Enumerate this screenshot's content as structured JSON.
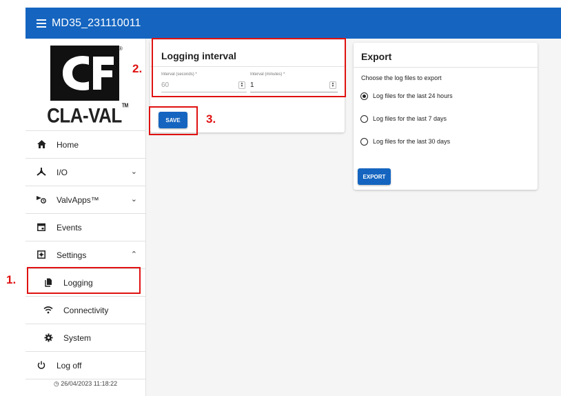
{
  "topbar": {
    "title": "MD35_231110011",
    "menu_icon": "hamburger-menu-icon",
    "background": "#1565c0"
  },
  "sidebar": {
    "logo": {
      "wordmark": "CLA-VAL",
      "trademark": "TM",
      "registered": "®"
    },
    "items": [
      {
        "label": "Home",
        "icon": "home-icon"
      },
      {
        "label": "I/O",
        "icon": "io-icon",
        "chevron": "down"
      },
      {
        "label": "ValvApps™",
        "icon": "valvapps-icon",
        "chevron": "down"
      },
      {
        "label": "Events",
        "icon": "calendar-icon"
      },
      {
        "label": "Settings",
        "icon": "settings-icon",
        "chevron": "up"
      },
      {
        "label": "Logging",
        "icon": "file-icon"
      },
      {
        "label": "Connectivity",
        "icon": "wifi-icon"
      },
      {
        "label": "System",
        "icon": "gear-icon"
      },
      {
        "label": "Log off",
        "icon": "power-icon"
      }
    ],
    "timestamp": "26/04/2023 11:18:22"
  },
  "logging_card": {
    "title": "Logging interval",
    "seconds_label": "Interval (seconds) *",
    "seconds_value": "60",
    "minutes_label": "Interval (minutes) *",
    "minutes_value": "1",
    "save_label": "SAVE"
  },
  "export_card": {
    "title": "Export",
    "prompt": "Choose the log files to export",
    "options": [
      {
        "label": "Log files for the last 24 hours",
        "selected": true
      },
      {
        "label": "Log files for the last 7 days",
        "selected": false
      },
      {
        "label": "Log files for the last 30 days",
        "selected": false
      }
    ],
    "export_label": "EXPORT"
  },
  "annotations": {
    "step1": "1.",
    "step2": "2.",
    "step3": "3.",
    "color": "#e01010"
  }
}
